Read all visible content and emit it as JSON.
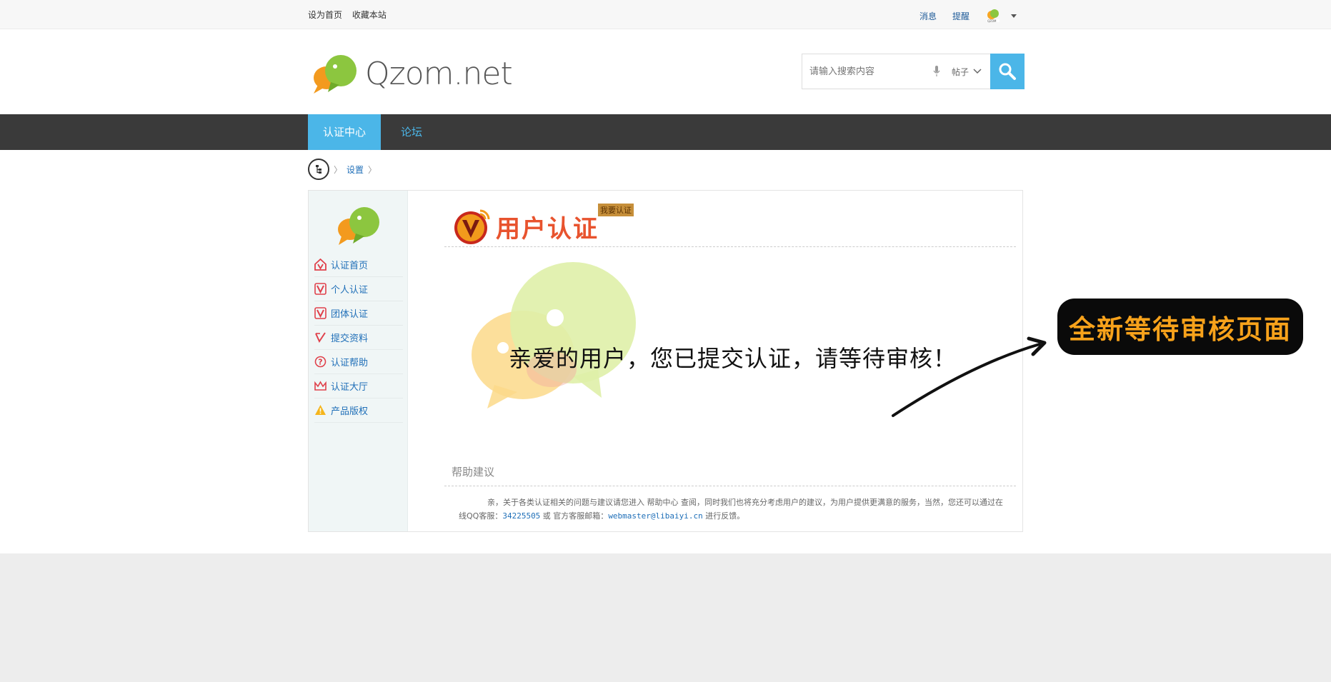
{
  "topbar": {
    "set_home": "设为首页",
    "bookmark": "收藏本站",
    "messages": "消息",
    "reminders": "提醒"
  },
  "header": {
    "logo_text": "Qzom.net",
    "search_placeholder": "请输入搜索内容",
    "search_type": "帖子"
  },
  "nav": {
    "tabs": [
      {
        "label": "认证中心",
        "active": true
      },
      {
        "label": "论坛",
        "active": false
      }
    ]
  },
  "breadcrumb": {
    "items": [
      "设置"
    ]
  },
  "sidebar": {
    "items": [
      {
        "label": "认证首页",
        "icon": "home-v-icon"
      },
      {
        "label": "个人认证",
        "icon": "v-box-icon"
      },
      {
        "label": "团体认证",
        "icon": "v-box-icon"
      },
      {
        "label": "提交资料",
        "icon": "v-submit-icon"
      },
      {
        "label": "认证帮助",
        "icon": "question-icon"
      },
      {
        "label": "认证大厅",
        "icon": "crown-icon"
      },
      {
        "label": "产品版权",
        "icon": "warning-icon"
      }
    ]
  },
  "main": {
    "title": "用户认证",
    "apply_tag": "我要认证",
    "pending_message": "亲爱的用户，您已提交认证，请等待审核！",
    "help_title": "帮助建议",
    "help_text_1": "亲，关于各类认证相关的问题与建议请您进入 帮助中心 查阅，同时我们也将充分考虑用户的建议，为用户提供更满意的服务，当然，您还可以通过在线QQ客服：",
    "qq_number": "34225505",
    "help_text_or": " 或 官方客服邮箱：",
    "email": "webmaster@libaiyi.cn",
    "help_text_end": " 进行反馈。"
  },
  "annotation": {
    "label": "全新等待审核页面"
  },
  "colors": {
    "accent": "#4bb6e8",
    "nav_bg": "#3a3a3a",
    "link": "#1f6fb8",
    "title_orange": "#e8532e",
    "annotation_text": "#f7a21b"
  }
}
